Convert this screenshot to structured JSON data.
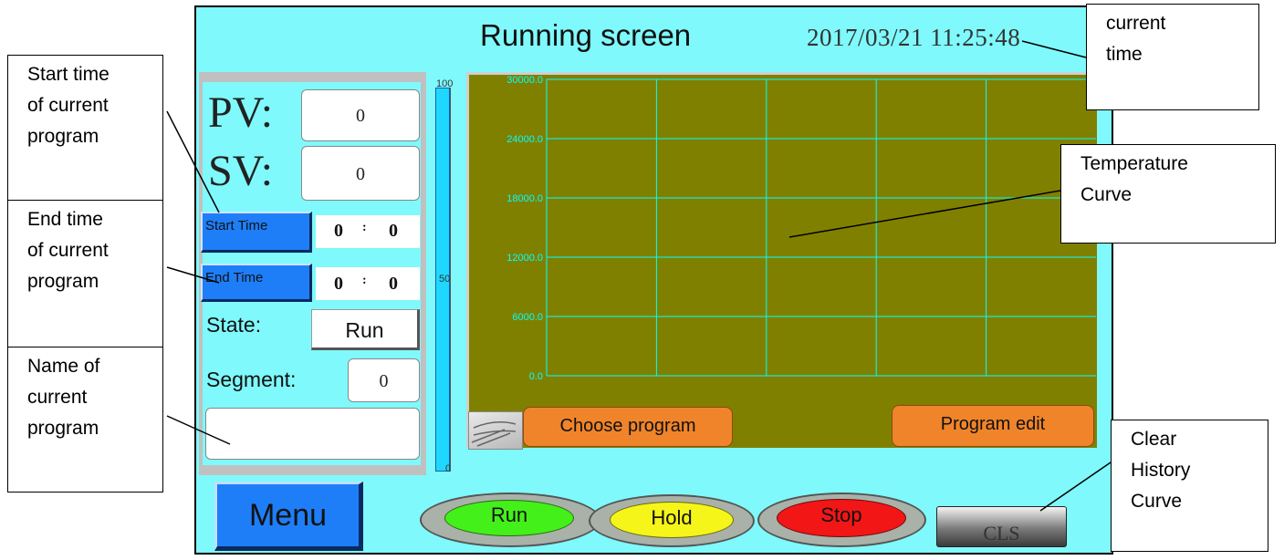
{
  "header": {
    "title": "Running screen",
    "datetime": "2017/03/21 11:25:48"
  },
  "readings": {
    "pv_label": "PV:",
    "pv_value": "0",
    "sv_label": "SV:",
    "sv_value": "0",
    "start_time_label": "Start Time",
    "start_time_hour": "0",
    "start_time_sep": ":",
    "start_time_min": "0",
    "end_time_label": "End Time",
    "end_time_hour": "0",
    "end_time_sep": ":",
    "end_time_min": "0",
    "state_label": "State:",
    "state_value": "Run",
    "segment_label": "Segment:",
    "segment_value": "0",
    "program_name": ""
  },
  "bar_scale": {
    "top": "100",
    "mid": "50",
    "bottom": "0",
    "level": 0
  },
  "chart_data": {
    "type": "line",
    "title": "",
    "xlabel": "",
    "ylabel": "",
    "y_ticks": [
      "30000.0",
      "24000.0",
      "18000.0",
      "12000.0",
      "6000.0",
      "0.0"
    ],
    "ylim": [
      0,
      30000
    ],
    "grid": true,
    "series": [],
    "background_color": "#808000",
    "grid_color": "#00ffff"
  },
  "chart_buttons": {
    "choose_program": "Choose program",
    "program_edit": "Program edit"
  },
  "bottom": {
    "menu": "Menu",
    "run": "Run",
    "hold": "Hold",
    "stop": "Stop",
    "cls": "CLS"
  },
  "colors": {
    "screen_bg": "#7ff9fb",
    "run_button": "#44f01a",
    "hold_button": "#f5f51a",
    "stop_button": "#f21616",
    "menu_button": "#1e7ef8",
    "orange_button": "#f0842a"
  },
  "callouts": {
    "start_time": "Start time\nof current\nprogram",
    "end_time": "End time\nof current\nprogram",
    "program_name": "Name of\ncurrent\nprogram",
    "current_time": "current\ntime",
    "temperature_curve": "Temperature\nCurve",
    "clear_history": "Clear\nHistory\nCurve"
  }
}
